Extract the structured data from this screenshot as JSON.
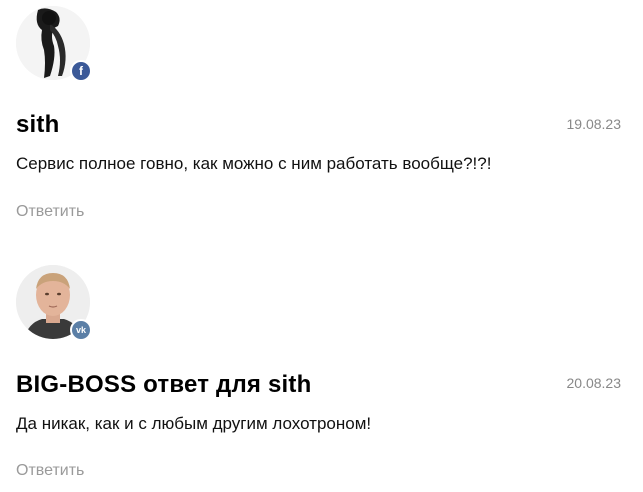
{
  "comments": [
    {
      "author": "sith",
      "date": "19.08.23",
      "text": "Сервис полное говно, как можно с ним работать вообще?!?!",
      "reply_label": "Ответить",
      "social": "f",
      "social_icon": "facebook-icon"
    },
    {
      "author": "BIG-BOSS ответ для sith",
      "date": "20.08.23",
      "text": "Да никак, как и с любым другим лохотроном!",
      "reply_label": "Ответить",
      "social": "vk",
      "social_icon": "vk-icon"
    }
  ]
}
